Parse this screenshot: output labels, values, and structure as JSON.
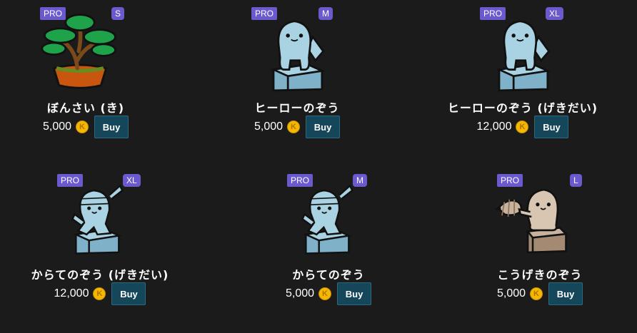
{
  "currency_icon": "coin-icon",
  "buy_label": "Buy",
  "items": [
    {
      "name": "ぼんさい (き)",
      "price": "5,000",
      "tier": "PRO",
      "size": "S",
      "art": "bonsai-tree-icon"
    },
    {
      "name": "ヒーローのぞう",
      "price": "5,000",
      "tier": "PRO",
      "size": "M",
      "art": "hero-statue-icon"
    },
    {
      "name": "ヒーローのぞう (げきだい)",
      "price": "12,000",
      "tier": "PRO",
      "size": "XL",
      "art": "hero-statue-icon"
    },
    {
      "name": "からてのぞう (げきだい)",
      "price": "12,000",
      "tier": "PRO",
      "size": "XL",
      "art": "karate-statue-icon"
    },
    {
      "name": "からてのぞう",
      "price": "5,000",
      "tier": "PRO",
      "size": "M",
      "art": "karate-statue-icon"
    },
    {
      "name": "こうげきのぞう",
      "price": "5,000",
      "tier": "PRO",
      "size": "L",
      "art": "attack-statue-icon"
    }
  ],
  "colors": {
    "background": "#1b1b1b",
    "badge": "#6a5acd",
    "buy_button": "#15465a",
    "coin": "#f5b800"
  }
}
